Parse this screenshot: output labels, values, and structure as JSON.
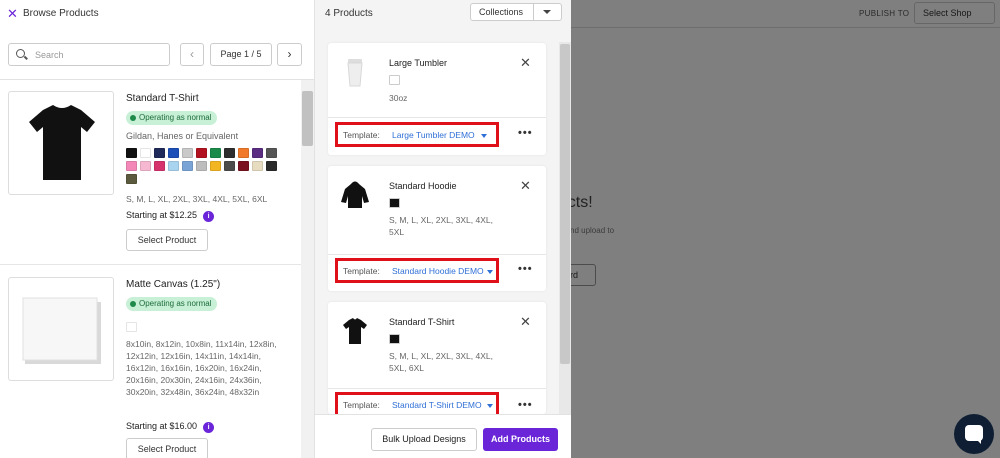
{
  "background": {
    "publish_to": "PUBLISH TO",
    "select_shop": "Select Shop",
    "heading_fragment": "ducts!",
    "subtext_fragment": "nd upload to",
    "button_fragment": "ard"
  },
  "browse": {
    "title": "Browse Products",
    "search_placeholder": "Search",
    "page_label": "Page 1 / 5",
    "prev": "‹",
    "next": "›"
  },
  "products": [
    {
      "name": "Standard T-Shirt",
      "status": "Operating as normal",
      "brand": "Gildan, Hanes or Equivalent",
      "swatches": [
        "#111111",
        "#ffffff",
        "#1f2a5a",
        "#1c4fb8",
        "#c9c9c9",
        "#b2121f",
        "#1a8b4a",
        "#2d2d2d",
        "#f07a2a",
        "#5a2d82",
        "#555555",
        "#f287b8",
        "#f6b8d0",
        "#d6336c",
        "#a9d4ef",
        "#7aa4d6",
        "#bdbdbd",
        "#f2b622",
        "#4b4b4b",
        "#7a1020",
        "#e8dcc0",
        "#2a2a2a",
        "#5b5a3e"
      ],
      "sizes": "S, M, L, XL, 2XL, 3XL, 4XL, 5XL, 6XL",
      "price": "Starting at $12.25",
      "select_label": "Select Product"
    },
    {
      "name": "Matte Canvas (1.25\")",
      "status": "Operating as normal",
      "swatches": [
        "#ffffff"
      ],
      "sizes": "8x10in, 8x12in, 10x8in, 11x14in, 12x8in, 12x12in, 12x16in, 14x11in, 14x14in, 16x12in, 16x16in, 16x20in, 16x24in, 20x16in, 20x30in, 24x16in, 24x36in, 30x20in, 32x48in, 36x24in, 48x32in",
      "price": "Starting at $16.00",
      "select_label": "Select Product"
    }
  ],
  "cart": {
    "title": "4 Products",
    "collections_label": "Collections",
    "template_label": "Template:",
    "items": [
      {
        "name": "Large Tumbler",
        "color": "#ffffff",
        "sizes": "30oz",
        "template": "Large Tumbler DEMO"
      },
      {
        "name": "Standard Hoodie",
        "color": "#111111",
        "sizes": "S, M, L, XL, 2XL, 3XL, 4XL, 5XL",
        "template": "Standard Hoodie DEMO"
      },
      {
        "name": "Standard T-Shirt",
        "color": "#111111",
        "sizes": "S, M, L, XL, 2XL, 3XL, 4XL, 5XL, 6XL",
        "template": "Standard T-Shirt DEMO"
      }
    ],
    "bulk_label": "Bulk Upload Designs",
    "add_label": "Add Products"
  },
  "colors": {
    "accent": "#6b25d8",
    "highlight": "#e0101a",
    "link": "#2f6fd6"
  }
}
